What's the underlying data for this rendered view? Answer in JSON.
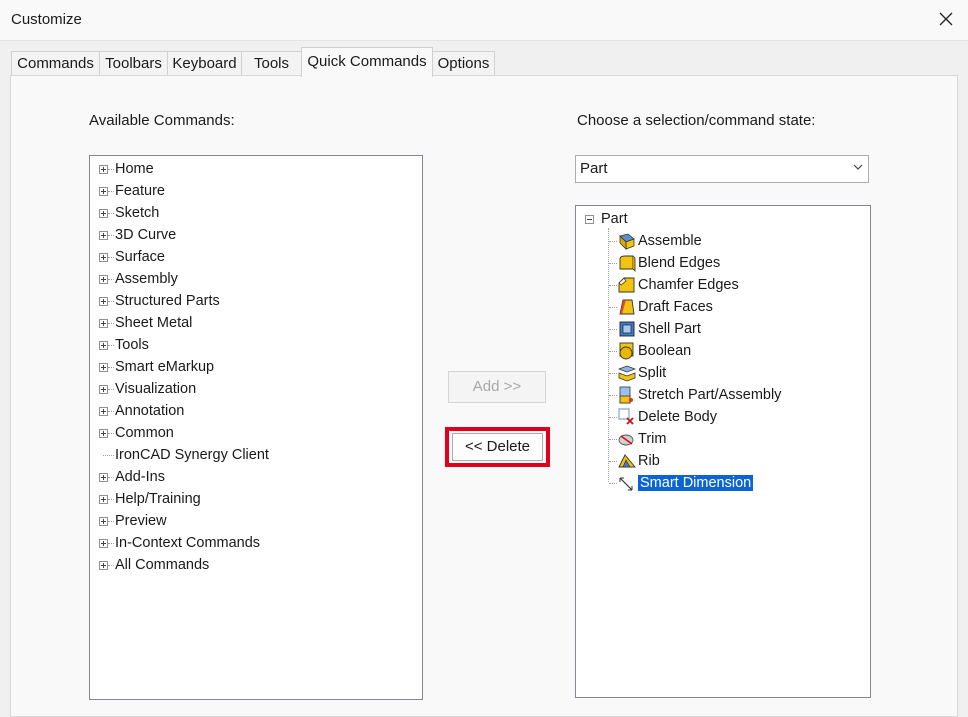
{
  "window": {
    "title": "Customize"
  },
  "tabs": [
    "Commands",
    "Toolbars",
    "Keyboard",
    "Tools",
    "Quick Commands",
    "Options"
  ],
  "active_tab": "Quick Commands",
  "left": {
    "label": "Available Commands:",
    "items": [
      {
        "label": "Home",
        "expandable": true
      },
      {
        "label": "Feature",
        "expandable": true
      },
      {
        "label": "Sketch",
        "expandable": true
      },
      {
        "label": "3D Curve",
        "expandable": true
      },
      {
        "label": "Surface",
        "expandable": true
      },
      {
        "label": "Assembly",
        "expandable": true
      },
      {
        "label": "Structured Parts",
        "expandable": true
      },
      {
        "label": "Sheet Metal",
        "expandable": true
      },
      {
        "label": "Tools",
        "expandable": true
      },
      {
        "label": "Smart eMarkup",
        "expandable": true
      },
      {
        "label": "Visualization",
        "expandable": true
      },
      {
        "label": "Annotation",
        "expandable": true
      },
      {
        "label": "Common",
        "expandable": true
      },
      {
        "label": "IronCAD Synergy Client",
        "expandable": false
      },
      {
        "label": "Add-Ins",
        "expandable": true
      },
      {
        "label": "Help/Training",
        "expandable": true
      },
      {
        "label": "Preview",
        "expandable": true
      },
      {
        "label": "In-Context Commands",
        "expandable": true
      },
      {
        "label": "All Commands",
        "expandable": true
      }
    ]
  },
  "buttons": {
    "add": "Add >>",
    "delete": "<< Delete"
  },
  "right": {
    "label": "Choose a selection/command state:",
    "dropdown_value": "Part",
    "tree_root": "Part",
    "items": [
      {
        "label": "Assemble",
        "icon": "assemble-icon"
      },
      {
        "label": "Blend Edges",
        "icon": "blend-edges-icon"
      },
      {
        "label": "Chamfer Edges",
        "icon": "chamfer-edges-icon"
      },
      {
        "label": "Draft Faces",
        "icon": "draft-faces-icon"
      },
      {
        "label": "Shell Part",
        "icon": "shell-part-icon"
      },
      {
        "label": "Boolean",
        "icon": "boolean-icon"
      },
      {
        "label": "Split",
        "icon": "split-icon"
      },
      {
        "label": "Stretch Part/Assembly",
        "icon": "stretch-icon"
      },
      {
        "label": "Delete Body",
        "icon": "delete-body-icon"
      },
      {
        "label": "Trim",
        "icon": "trim-icon"
      },
      {
        "label": "Rib",
        "icon": "rib-icon"
      },
      {
        "label": "Smart Dimension",
        "icon": "smart-dimension-icon",
        "selected": true
      }
    ]
  },
  "colors": {
    "selection": "#0a64d6",
    "highlight_outline": "#e0001b"
  }
}
